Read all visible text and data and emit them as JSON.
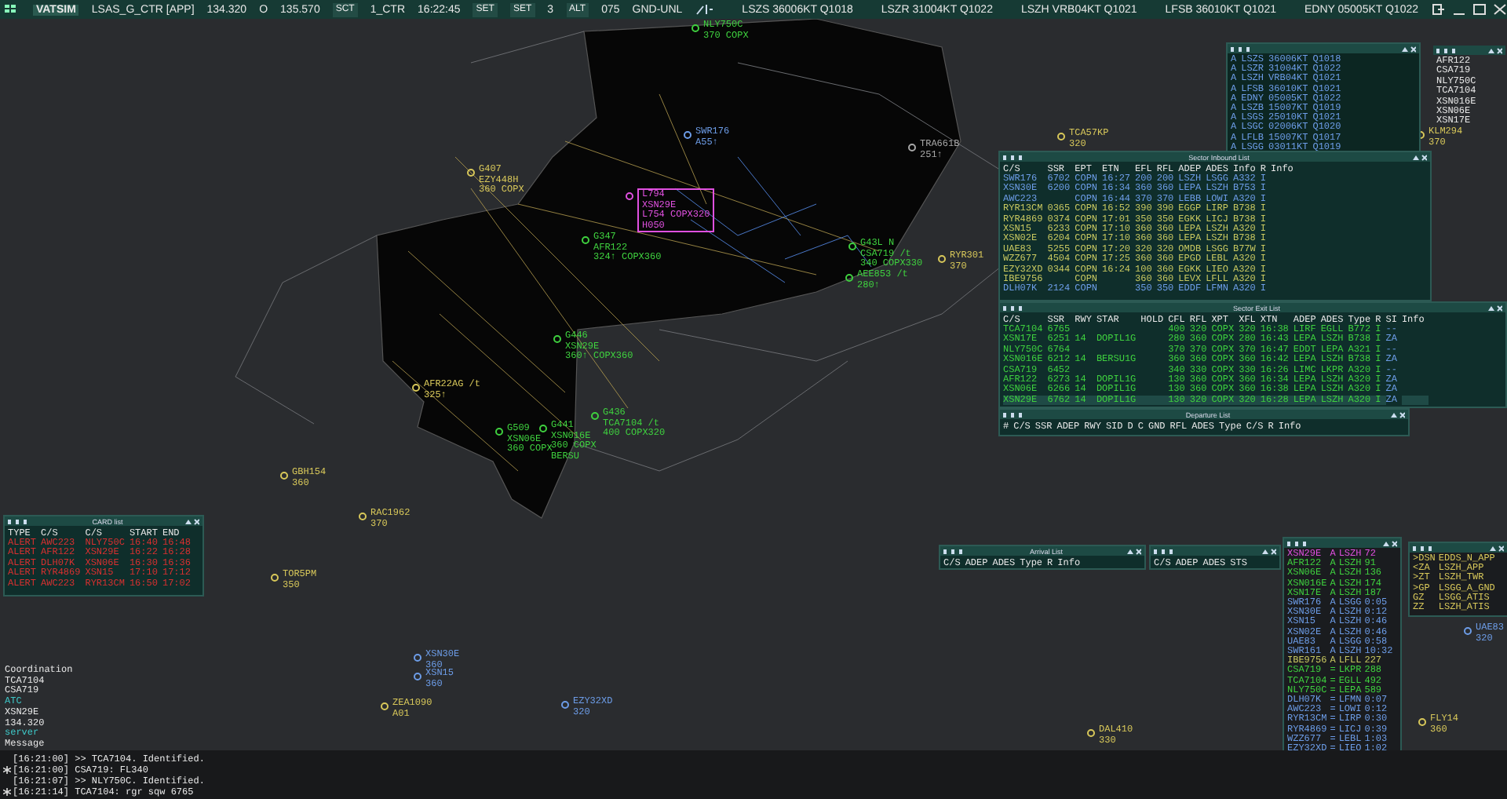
{
  "top_bar": {
    "logo": "VATSIM",
    "items": [
      {
        "kind": "label",
        "text": "LSAS_G_CTR [APP]"
      },
      {
        "kind": "freq",
        "text": "134.320"
      },
      {
        "kind": "label",
        "text": "O"
      },
      {
        "kind": "freq",
        "text": "135.570"
      },
      {
        "kind": "button",
        "text": "SCT"
      },
      {
        "kind": "label",
        "text": "1_CTR"
      },
      {
        "kind": "clock",
        "text": "16:22:45"
      },
      {
        "kind": "button",
        "text": "SET"
      },
      {
        "kind": "button",
        "text": "SET"
      },
      {
        "kind": "label",
        "text": "3"
      },
      {
        "kind": "button",
        "text": "ALT"
      },
      {
        "kind": "label",
        "text": "075"
      },
      {
        "kind": "label",
        "text": "GND-UNL"
      },
      {
        "kind": "metar",
        "text": "LSZS 36006KT Q1018"
      },
      {
        "kind": "metar",
        "text": "LSZR 31004KT Q1022"
      },
      {
        "kind": "metar",
        "text": "LSZH VRB04KT Q1021"
      },
      {
        "kind": "metar",
        "text": "LFSB 36010KT Q1021"
      },
      {
        "kind": "metar",
        "text": "EDNY 05005KT Q1022"
      }
    ]
  },
  "tracks": [
    {
      "lines": [
        "NLY750C",
        "370 COPX"
      ],
      "color": "#3fd13f",
      "kind": "plain"
    },
    {
      "lines": [
        "SWR176",
        "A55↑"
      ],
      "color": "#6d9de8",
      "kind": "plain"
    },
    {
      "lines": [
        "TRA661B",
        "251↑"
      ],
      "color": "#a8a8a8",
      "kind": "plain"
    },
    {
      "lines": [
        "TCA57KP",
        "320"
      ],
      "color": "#d8c85a",
      "kind": "plain"
    },
    {
      "lines": [
        "KLM294",
        "370"
      ],
      "color": "#d8c85a",
      "kind": "plain"
    },
    {
      "lines": [
        "G407",
        "EZY448H",
        "360 COPX"
      ],
      "color": "#d8c85a",
      "kind": "plain"
    },
    {
      "lines": [
        "L794",
        "XSN29E",
        "L754 COPX320",
        "H050"
      ],
      "color": "#e050e0",
      "kind": "boxed"
    },
    {
      "lines": [
        "G347",
        "AFR122",
        "324↑ COPX360"
      ],
      "color": "#3fd13f",
      "kind": "plain"
    },
    {
      "lines": [
        "G43L N",
        "CSA719 /t",
        "340 COPX330"
      ],
      "color": "#3fd13f",
      "kind": "plain"
    },
    {
      "lines": [
        "AEE853 /t",
        "280↑"
      ],
      "color": "#3fd13f",
      "kind": "plain"
    },
    {
      "lines": [
        "RYR301",
        "370"
      ],
      "color": "#d8c85a",
      "kind": "plain"
    },
    {
      "lines": [
        "G446",
        "XSN29E",
        "360↑ COPX360"
      ],
      "color": "#3fd13f",
      "kind": "plain"
    },
    {
      "lines": [
        "AFR22AG /t",
        "325↑"
      ],
      "color": "#d8c85a",
      "kind": "plain"
    },
    {
      "lines": [
        "G436",
        "TCA7104 /t",
        "400 COPX320"
      ],
      "color": "#3fd13f",
      "kind": "plain"
    },
    {
      "lines": [
        "G509",
        "XSN06E",
        "360 COPX"
      ],
      "color": "#3fd13f",
      "kind": "plain"
    },
    {
      "lines": [
        "G441",
        "XSN016E",
        "360 COPX",
        "BERSU"
      ],
      "color": "#3fd13f",
      "kind": "plain"
    },
    {
      "lines": [
        "GBH154",
        "360"
      ],
      "color": "#d8c85a",
      "kind": "plain"
    },
    {
      "lines": [
        "RAC1962",
        "370"
      ],
      "color": "#d8c85a",
      "kind": "plain"
    },
    {
      "lines": [
        "TOR5PM",
        "350"
      ],
      "color": "#d8c85a",
      "kind": "plain"
    },
    {
      "lines": [
        "XSN30E",
        "360"
      ],
      "color": "#6d9de8",
      "kind": "plain"
    },
    {
      "lines": [
        "XSN15",
        "360"
      ],
      "color": "#6d9de8",
      "kind": "plain"
    },
    {
      "lines": [
        "ZEA1090",
        "A01"
      ],
      "color": "#d8c85a",
      "kind": "plain"
    },
    {
      "lines": [
        "EZY32XD",
        "320"
      ],
      "color": "#6d9de8",
      "kind": "plain"
    },
    {
      "lines": [
        "DAL410",
        "330"
      ],
      "color": "#d8c85a",
      "kind": "plain"
    },
    {
      "lines": [
        "FLY14",
        "360"
      ],
      "color": "#d8c85a",
      "kind": "plain"
    },
    {
      "lines": [
        "UAE83",
        "320"
      ],
      "color": "#6d9de8",
      "kind": "plain"
    }
  ],
  "panels": {
    "metar": {
      "rows": [
        {
          "cells": [
            "A",
            "LSZS",
            "36006KT",
            "Q1018"
          ],
          "color": "#6d9de8"
        },
        {
          "cells": [
            "A",
            "LSZR",
            "31004KT",
            "Q1022"
          ],
          "color": "#6d9de8"
        },
        {
          "cells": [
            "A",
            "LSZH",
            "VRB04KT",
            "Q1021"
          ],
          "color": "#6d9de8"
        },
        {
          "cells": [
            "A",
            "LFSB",
            "36010KT",
            "Q1021"
          ],
          "color": "#6d9de8"
        },
        {
          "cells": [
            "A",
            "EDNY",
            "05005KT",
            "Q1022"
          ],
          "color": "#6d9de8"
        },
        {
          "cells": [
            "A",
            "LSZB",
            "15007KT",
            "Q1019"
          ],
          "color": "#6d9de8"
        },
        {
          "cells": [
            "A",
            "LSGS",
            "25010KT",
            "Q1021"
          ],
          "color": "#6d9de8"
        },
        {
          "cells": [
            "A",
            "LSGC",
            "02006KT",
            "Q1020"
          ],
          "color": "#6d9de8"
        },
        {
          "cells": [
            "A",
            "LFLB",
            "15007KT",
            "Q1017"
          ],
          "color": "#6d9de8"
        },
        {
          "cells": [
            "A",
            "LSGG",
            "03011KT",
            "Q1019"
          ],
          "color": "#6d9de8"
        }
      ]
    },
    "aircraft": {
      "rows": [
        {
          "cells": [
            "AFR122"
          ],
          "color": "#e8e8e8"
        },
        {
          "cells": [
            "CSA719"
          ],
          "color": "#e8e8e8"
        },
        {
          "cells": [
            "NLY750C"
          ],
          "color": "#e8e8e8"
        },
        {
          "cells": [
            "TCA7104"
          ],
          "color": "#e8e8e8"
        },
        {
          "cells": [
            "XSN016E"
          ],
          "color": "#e8e8e8"
        },
        {
          "cells": [
            "XSN06E"
          ],
          "color": "#e8e8e8"
        },
        {
          "cells": [
            "XSN17E"
          ],
          "color": "#e8e8e8"
        }
      ]
    },
    "inbound": {
      "title": "Sector Inbound List",
      "columns": [
        "C/S",
        "SSR",
        "EPT",
        "ETN",
        "EFL",
        "RFL",
        "ADEP",
        "ADES",
        "Info",
        "R",
        "Info"
      ],
      "rows": [
        {
          "cells": [
            "SWR176",
            "6702",
            "COPN",
            "16:27",
            "200",
            "200",
            "LSZH",
            "LSGG",
            "A332",
            "I",
            ""
          ],
          "color": "#6d9de8"
        },
        {
          "cells": [
            "XSN30E",
            "6200",
            "COPN",
            "16:34",
            "360",
            "360",
            "LEPA",
            "LSZH",
            "B753",
            "I",
            ""
          ],
          "color": "#6d9de8"
        },
        {
          "cells": [
            "AWC223",
            "",
            "COPN",
            "16:44",
            "370",
            "370",
            "LEBB",
            "LOWI",
            "A320",
            "I",
            ""
          ],
          "color": "#6d9de8"
        },
        {
          "cells": [
            "RYR13CM",
            "0365",
            "COPN",
            "16:52",
            "390",
            "390",
            "EGGP",
            "LIRP",
            "B738",
            "I",
            ""
          ],
          "color": "#c8c860"
        },
        {
          "cells": [
            "RYR4869",
            "0374",
            "COPN",
            "17:01",
            "350",
            "350",
            "EGKK",
            "LICJ",
            "B738",
            "I",
            ""
          ],
          "color": "#c8c860"
        },
        {
          "cells": [
            "XSN15",
            "6233",
            "COPN",
            "17:10",
            "360",
            "360",
            "LEPA",
            "LSZH",
            "A320",
            "I",
            ""
          ],
          "color": "#c8c860"
        },
        {
          "cells": [
            "XSN02E",
            "6204",
            "COPN",
            "17:10",
            "360",
            "360",
            "LEPA",
            "LSZH",
            "B738",
            "I",
            ""
          ],
          "color": "#c8c860"
        },
        {
          "cells": [
            "UAE83",
            "5255",
            "COPN",
            "17:20",
            "320",
            "320",
            "OMDB",
            "LSGG",
            "B77W",
            "I",
            ""
          ],
          "color": "#c8c860"
        },
        {
          "cells": [
            "WZZ677",
            "4504",
            "COPN",
            "17:25",
            "360",
            "360",
            "EPGD",
            "LEBL",
            "A320",
            "I",
            ""
          ],
          "color": "#c8c860"
        },
        {
          "cells": [
            "EZY32XD",
            "0344",
            "COPN",
            "16:24",
            "100",
            "360",
            "EGKK",
            "LIEO",
            "A320",
            "I",
            ""
          ],
          "color": "#c8c860"
        },
        {
          "cells": [
            "IBE9756",
            "",
            "COPN",
            "",
            "360",
            "360",
            "LEVX",
            "LFLL",
            "A320",
            "I",
            ""
          ],
          "color": "#c8c860"
        },
        {
          "cells": [
            "DLH07K",
            "2124",
            "COPN",
            "",
            "350",
            "350",
            "EDDF",
            "LFMN",
            "A320",
            "I",
            ""
          ],
          "color": "#6d9de8"
        }
      ]
    },
    "exit": {
      "title": "Sector Exit List",
      "columns": [
        "C/S",
        "SSR",
        "RWY",
        "STAR",
        "HOLD",
        "CFL",
        "RFL",
        "XPT",
        "XFL",
        "XTN",
        "ADEP",
        "ADES",
        "Type",
        "R",
        "SI",
        "Info"
      ],
      "rows": [
        {
          "cells": [
            "TCA7104",
            "6765",
            "",
            "",
            "",
            "400",
            "320",
            "COPX",
            "320",
            "16:38",
            "LIRF",
            "EGLL",
            "B772",
            "I",
            "--",
            ""
          ],
          "color": "#3fd13f",
          "selected": false
        },
        {
          "cells": [
            "XSN17E",
            "6251",
            "14",
            "DOPIL1G",
            "",
            "280",
            "360",
            "COPX",
            "280",
            "16:43",
            "LEPA",
            "LSZH",
            "B738",
            "I",
            "ZA",
            ""
          ],
          "color": "#3fd13f",
          "selected": false
        },
        {
          "cells": [
            "NLY750C",
            "6764",
            "",
            "",
            "",
            "370",
            "370",
            "COPX",
            "370",
            "16:47",
            "EDDT",
            "LEPA",
            "A321",
            "I",
            "--",
            ""
          ],
          "color": "#3fd13f",
          "selected": false
        },
        {
          "cells": [
            "XSN016E",
            "6212",
            "14",
            "BERSU1G",
            "",
            "360",
            "360",
            "COPX",
            "360",
            "16:42",
            "LEPA",
            "LSZH",
            "B738",
            "I",
            "ZA",
            ""
          ],
          "color": "#3fd13f",
          "selected": false
        },
        {
          "cells": [
            "CSA719",
            "6452",
            "",
            "",
            "",
            "340",
            "330",
            "COPX",
            "330",
            "16:26",
            "LIMC",
            "LKPR",
            "A320",
            "I",
            "--",
            ""
          ],
          "color": "#3fd13f",
          "selected": false
        },
        {
          "cells": [
            "AFR122",
            "6273",
            "14",
            "DOPIL1G",
            "",
            "130",
            "360",
            "COPX",
            "360",
            "16:34",
            "LEPA",
            "LSZH",
            "A320",
            "I",
            "ZA",
            ""
          ],
          "color": "#3fd13f",
          "selected": false
        },
        {
          "cells": [
            "XSN06E",
            "6266",
            "14",
            "DOPIL1G",
            "",
            "130",
            "360",
            "COPX",
            "360",
            "16:38",
            "LEPA",
            "LSZH",
            "A320",
            "I",
            "ZA",
            ""
          ],
          "color": "#3fd13f",
          "selected": false
        },
        {
          "cells": [
            "XSN29E",
            "6762",
            "14",
            "DOPIL1G",
            "",
            "130",
            "320",
            "COPX",
            "320",
            "16:28",
            "LEPA",
            "LSZH",
            "A320",
            "I",
            "ZA",
            ""
          ],
          "color": "#3fd13f",
          "selected": true
        }
      ]
    },
    "departure": {
      "title": "Departure List",
      "columns": [
        "#",
        "C/S",
        "SSR",
        "ADEP",
        "RWY",
        "SID",
        "D",
        "C",
        "GND",
        "RFL",
        "ADES",
        "Type",
        "C/S",
        "R",
        "Info"
      ]
    },
    "card": {
      "title": "CARD list",
      "columns": [
        "TYPE",
        "C/S",
        "C/S",
        "START",
        "END"
      ],
      "rows": [
        {
          "cells": [
            "ALERT",
            "AWC223",
            "NLY750C",
            "16:40",
            "16:48"
          ],
          "color": "#d83030"
        },
        {
          "cells": [
            "ALERT",
            "AFR122",
            "XSN29E",
            "16:22",
            "16:28"
          ],
          "color": "#d83030"
        },
        {
          "cells": [
            "ALERT",
            "DLH07K",
            "XSN06E",
            "16:30",
            "16:36"
          ],
          "color": "#d83030"
        },
        {
          "cells": [
            "ALERT",
            "RYR4869",
            "XSN15",
            "17:10",
            "17:12"
          ],
          "color": "#d83030"
        },
        {
          "cells": [
            "ALERT",
            "AWC223",
            "RYR13CM",
            "16:50",
            "17:02"
          ],
          "color": "#d83030"
        }
      ]
    },
    "arrival": {
      "title": "Arrival List",
      "columns": [
        "C/S",
        "ADEP",
        "ADES",
        "Type",
        "R",
        "Info"
      ]
    },
    "strip": {
      "columns": [
        "C/S",
        "ADEP",
        "ADES",
        "STS"
      ]
    },
    "flights": {
      "rows": [
        {
          "cells": [
            "XSN29E",
            "A",
            "LSZH",
            "72"
          ],
          "color": "#e050e0"
        },
        {
          "cells": [
            "AFR122",
            "A",
            "LSZH",
            "91"
          ],
          "color": "#3fd13f"
        },
        {
          "cells": [
            "XSN06E",
            "A",
            "LSZH",
            "136"
          ],
          "color": "#3fd13f"
        },
        {
          "cells": [
            "XSN016E",
            "A",
            "LSZH",
            "174"
          ],
          "color": "#3fd13f"
        },
        {
          "cells": [
            "XSN17E",
            "A",
            "LSZH",
            "187"
          ],
          "color": "#3fd13f"
        },
        {
          "cells": [
            "SWR176",
            "A",
            "LSGG",
            "0:05"
          ],
          "color": "#6d9de8"
        },
        {
          "cells": [
            "XSN30E",
            "A",
            "LSZH",
            "0:12"
          ],
          "color": "#6d9de8"
        },
        {
          "cells": [
            "XSN15",
            "A",
            "LSZH",
            "0:46"
          ],
          "color": "#6d9de8"
        },
        {
          "cells": [
            "XSN02E",
            "A",
            "LSZH",
            "0:46"
          ],
          "color": "#6d9de8"
        },
        {
          "cells": [
            "UAE83",
            "A",
            "LSGG",
            "0:58"
          ],
          "color": "#6d9de8"
        },
        {
          "cells": [
            "SWR161",
            "A",
            "LSZH",
            "10:32"
          ],
          "color": "#6d9de8"
        },
        {
          "cells": [
            "IBE9756",
            "A",
            "LFLL",
            "227"
          ],
          "color": "#c8c860"
        },
        {
          "cells": [
            "CSA719",
            "=",
            "LKPR",
            "288"
          ],
          "color": "#3fd13f"
        },
        {
          "cells": [
            "TCA7104",
            "=",
            "EGLL",
            "492"
          ],
          "color": "#3fd13f"
        },
        {
          "cells": [
            "NLY750C",
            "=",
            "LEPA",
            "589"
          ],
          "color": "#3fd13f"
        },
        {
          "cells": [
            "DLH07K",
            "=",
            "LFMN",
            "0:07"
          ],
          "color": "#6d9de8"
        },
        {
          "cells": [
            "AWC223",
            "=",
            "LOWI",
            "0:12"
          ],
          "color": "#6d9de8"
        },
        {
          "cells": [
            "RYR13CM",
            "=",
            "LIRP",
            "0:30"
          ],
          "color": "#6d9de8"
        },
        {
          "cells": [
            "RYR4869",
            "=",
            "LICJ",
            "0:39"
          ],
          "color": "#6d9de8"
        },
        {
          "cells": [
            "WZZ677",
            "=",
            "LEBL",
            "1:03"
          ],
          "color": "#6d9de8"
        },
        {
          "cells": [
            "EZY32XD",
            "=",
            "LIEO",
            "1:02"
          ],
          "color": "#6d9de8"
        }
      ]
    },
    "frequencies": {
      "rows": [
        {
          "cells": [
            ">DSN",
            "EDDS_N_APP"
          ],
          "color": "#d8c85a"
        },
        {
          "cells": [
            "<ZA",
            "LSZH_APP"
          ],
          "color": "#d8c85a"
        },
        {
          "cells": [
            ">ZT",
            "LSZH_TWR"
          ],
          "color": "#d8c85a"
        },
        {
          "cells": [
            ">GP",
            "LSGG_A_GND"
          ],
          "color": "#d8c85a"
        },
        {
          "cells": [
            "GZ",
            "LSGG_ATIS"
          ],
          "color": "#d8c85a"
        },
        {
          "cells": [
            "ZZ",
            "LSZH_ATIS"
          ],
          "color": "#d8c85a"
        }
      ]
    }
  },
  "coordination": [
    {
      "text": "Coordination",
      "kind": "plain"
    },
    {
      "text": "TCA7104",
      "kind": "plain"
    },
    {
      "text": "CSA719",
      "kind": "plain"
    },
    {
      "text": "ATC",
      "kind": "heading"
    },
    {
      "text": "XSN29E",
      "kind": "plain"
    },
    {
      "text": "134.320",
      "kind": "plain"
    },
    {
      "text": "server",
      "kind": "heading"
    },
    {
      "text": "Message",
      "kind": "plain"
    }
  ],
  "messages": [
    {
      "time": "[16:21:00]",
      "text": ">> TCA7104. Identified.",
      "starred": false
    },
    {
      "time": "[16:21:00]",
      "text": "CSA719: FL340",
      "starred": true
    },
    {
      "time": "[16:21:07]",
      "text": ">> NLY750C. Identified.",
      "starred": false
    },
    {
      "time": "[16:21:14]",
      "text": "TCA7104: rgr sqw 6765",
      "starred": true
    }
  ]
}
